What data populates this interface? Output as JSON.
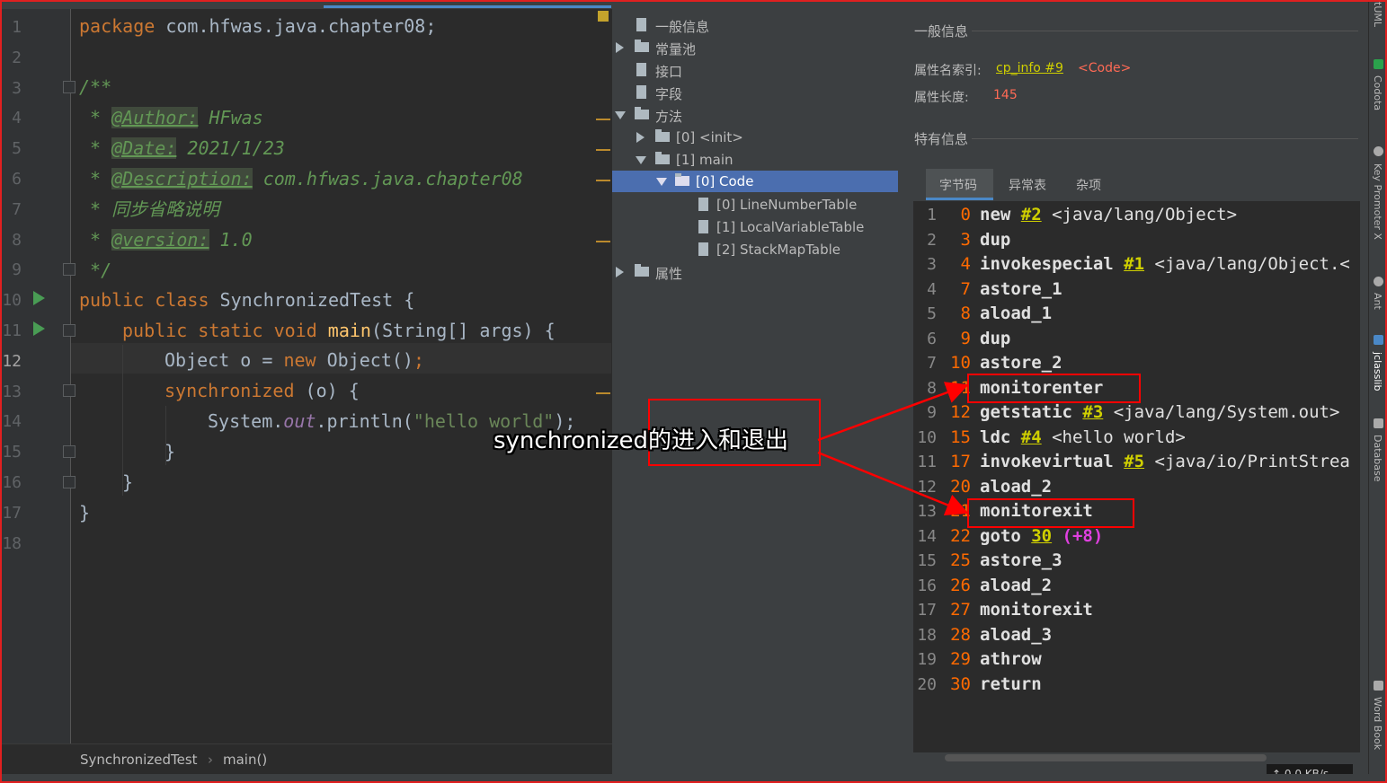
{
  "editor": {
    "line_numbers": [
      "1",
      "2",
      "3",
      "4",
      "5",
      "6",
      "7",
      "8",
      "9",
      "10",
      "11",
      "12",
      "13",
      "14",
      "15",
      "16",
      "17",
      "18"
    ],
    "current_line": "12",
    "code": {
      "l1_kw": "package",
      "l1_rest": " com.hfwas.java.chapter08;",
      "l3": "/**",
      "l4_pre": " * ",
      "l4_tag": "@Author:",
      "l4_rest": " HFwas",
      "l5_pre": " * ",
      "l5_tag": "@Date:",
      "l5_rest": " 2021/1/23",
      "l6_pre": " * ",
      "l6_tag": "@Description:",
      "l6_rest": " com.hfwas.java.chapter08",
      "l7": " * 同步省略说明",
      "l8_pre": " * ",
      "l8_tag": "@version:",
      "l8_rest": " 1.0",
      "l9": " */",
      "l10_kw": "public class",
      "l10_rest": " SynchronizedTest {",
      "l11_kw": "public static void",
      "l11_fn": "main",
      "l11_rest": "(String[] args) {",
      "l12_a": "Object o = ",
      "l12_kw": "new",
      "l12_b": " Object()",
      "l12_semi": ";",
      "l13_kw": "synchronized",
      "l13_rest": " (o) {",
      "l14_a": "System.",
      "l14_fld": "out",
      "l14_b": ".println(",
      "l14_str": "\"hello world\"",
      "l14_c": ");",
      "l15": "}",
      "l16": "}",
      "l17": "}"
    },
    "breadcrumb": [
      "SynchronizedTest",
      "main()"
    ]
  },
  "tree": {
    "items": [
      {
        "label": "一般信息"
      },
      {
        "label": "常量池"
      },
      {
        "label": "接口"
      },
      {
        "label": "字段"
      },
      {
        "label": "方法"
      },
      {
        "label": "[0] <init>"
      },
      {
        "label": "[1] main"
      },
      {
        "label": "[0] Code"
      },
      {
        "label": "[0] LineNumberTable"
      },
      {
        "label": "[1] LocalVariableTable"
      },
      {
        "label": "[2] StackMapTable"
      },
      {
        "label": "属性"
      }
    ]
  },
  "info": {
    "general_title": "一般信息",
    "name_index_label": "属性名索引:",
    "name_index_link": "cp_info #9",
    "name_index_value": "<Code>",
    "length_label": "属性长度:",
    "length_value": "145",
    "specific_title": "特有信息",
    "tabs": [
      "字节码",
      "异常表",
      "杂项"
    ],
    "active_tab": "字节码",
    "bytecode": [
      {
        "n": "1",
        "off": "0",
        "op": "new",
        "ref": "#2",
        "extra": " <java/lang/Object>"
      },
      {
        "n": "2",
        "off": "3",
        "op": "dup",
        "ref": "",
        "extra": ""
      },
      {
        "n": "3",
        "off": "4",
        "op": "invokespecial",
        "ref": "#1",
        "extra": " <java/lang/Object.<"
      },
      {
        "n": "4",
        "off": "7",
        "op": "astore_1",
        "ref": "",
        "extra": ""
      },
      {
        "n": "5",
        "off": "8",
        "op": "aload_1",
        "ref": "",
        "extra": ""
      },
      {
        "n": "6",
        "off": "9",
        "op": "dup",
        "ref": "",
        "extra": ""
      },
      {
        "n": "7",
        "off": "10",
        "op": "astore_2",
        "ref": "",
        "extra": ""
      },
      {
        "n": "8",
        "off": "11",
        "op": "monitorenter",
        "ref": "",
        "extra": ""
      },
      {
        "n": "9",
        "off": "12",
        "op": "getstatic",
        "ref": "#3",
        "extra": " <java/lang/System.out>"
      },
      {
        "n": "10",
        "off": "15",
        "op": "ldc",
        "ref": "#4",
        "extra": " <hello world>"
      },
      {
        "n": "11",
        "off": "17",
        "op": "invokevirtual",
        "ref": "#5",
        "extra": " <java/io/PrintStrea"
      },
      {
        "n": "12",
        "off": "20",
        "op": "aload_2",
        "ref": "",
        "extra": ""
      },
      {
        "n": "13",
        "off": "21",
        "op": "monitorexit",
        "ref": "",
        "extra": ""
      },
      {
        "n": "14",
        "off": "22",
        "op": "goto",
        "ref": "30",
        "extra": "",
        "jump": " (+8)"
      },
      {
        "n": "15",
        "off": "25",
        "op": "astore_3",
        "ref": "",
        "extra": ""
      },
      {
        "n": "16",
        "off": "26",
        "op": "aload_2",
        "ref": "",
        "extra": ""
      },
      {
        "n": "17",
        "off": "27",
        "op": "monitorexit",
        "ref": "",
        "extra": ""
      },
      {
        "n": "18",
        "off": "28",
        "op": "aload_3",
        "ref": "",
        "extra": ""
      },
      {
        "n": "19",
        "off": "29",
        "op": "athrow",
        "ref": "",
        "extra": ""
      },
      {
        "n": "20",
        "off": "30",
        "op": "return",
        "ref": "",
        "extra": ""
      }
    ],
    "network": "↑ 0.0 KB/s"
  },
  "right_strip": [
    "tUML",
    "Codota",
    "Key Promoter X",
    "Ant",
    "jclasslib",
    "Database",
    "Word Book"
  ],
  "annotation": {
    "text": "synchronized的进入和退出"
  },
  "colors": {
    "editor_bg": "#2b2b2b",
    "panel_bg": "#3c3f41",
    "keyword": "#cc7832",
    "selection": "#4b6eaf",
    "annotation_red": "#ff0000",
    "bytecode_offset": "#ff6a00",
    "bytecode_ref": "#d0d000"
  }
}
